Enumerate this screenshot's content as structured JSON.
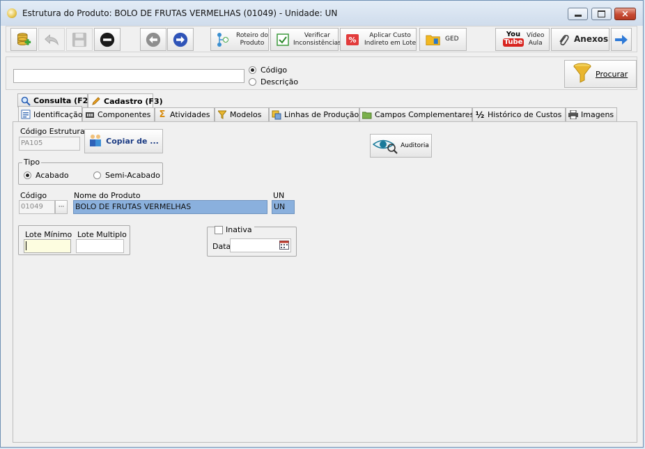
{
  "window": {
    "title": "Estrutura do Produto: BOLO DE FRUTAS VERMELHAS  (01049)   - Unidade: UN",
    "controls": {
      "minimize": "minimize",
      "maximize": "maximize",
      "close": "×"
    }
  },
  "toolbar": {
    "roteiro": "Roteiro do\nProduto",
    "verificar": "Verificar\nInconsistências",
    "aplicar": "Aplicar Custo\nIndireto em Lote",
    "aplicar_icon_text": "%",
    "ged": "GED",
    "video": "Vídeo\nAula",
    "youtube_you": "You",
    "youtube_tube": "Tube",
    "anexos": "Anexos"
  },
  "search": {
    "value": "",
    "options": [
      "Código",
      "Descrição"
    ],
    "selected": "Código",
    "procurar_label": "Procurar"
  },
  "main_tabs": [
    {
      "label": "Consulta (F2)",
      "icon": "magnifier-icon"
    },
    {
      "label": "Cadastro (F3)",
      "icon": "pencil-icon",
      "active": true
    }
  ],
  "sub_tabs": [
    {
      "label": "Identificação",
      "icon": "id-card-icon",
      "active": true
    },
    {
      "label": "Componentes",
      "icon": "components-icon"
    },
    {
      "label": "Atividades",
      "icon": "sigma-icon"
    },
    {
      "label": "Modelos",
      "icon": "funnel-icon"
    },
    {
      "label": "Linhas de Produção",
      "icon": "production-line-icon"
    },
    {
      "label": "Campos Complementares",
      "icon": "folder-icon"
    },
    {
      "label": "Histórico de Custos",
      "icon": "half-icon"
    },
    {
      "label": "Imagens",
      "icon": "printer-icon"
    }
  ],
  "form": {
    "codigo_estrutura_label": "Código Estrutura",
    "codigo_estrutura_value": "PA105",
    "copiar_label": "Copiar de ...",
    "auditoria_label": "Auditoria",
    "tipo_label": "Tipo",
    "tipo_options": [
      "Acabado",
      "Semi-Acabado"
    ],
    "tipo_selected": "Acabado",
    "codigo_label": "Código",
    "codigo_value": "01049",
    "lookup_label": "···",
    "nome_label": "Nome do Produto",
    "nome_value": "BOLO DE FRUTAS VERMELHAS",
    "un_label": "UN",
    "un_value": "UN",
    "lote_minimo_label": "Lote Mínimo",
    "lote_minimo_value": "",
    "lote_multiplo_label": "Lote Multiplo",
    "lote_multiplo_value": "",
    "inativa_label": "Inativa",
    "data_label": "Data",
    "data_value": ""
  },
  "colors": {
    "selection": "#8ab0dd",
    "active_input": "#fdfde0",
    "accent_blue": "#2f54b8"
  }
}
